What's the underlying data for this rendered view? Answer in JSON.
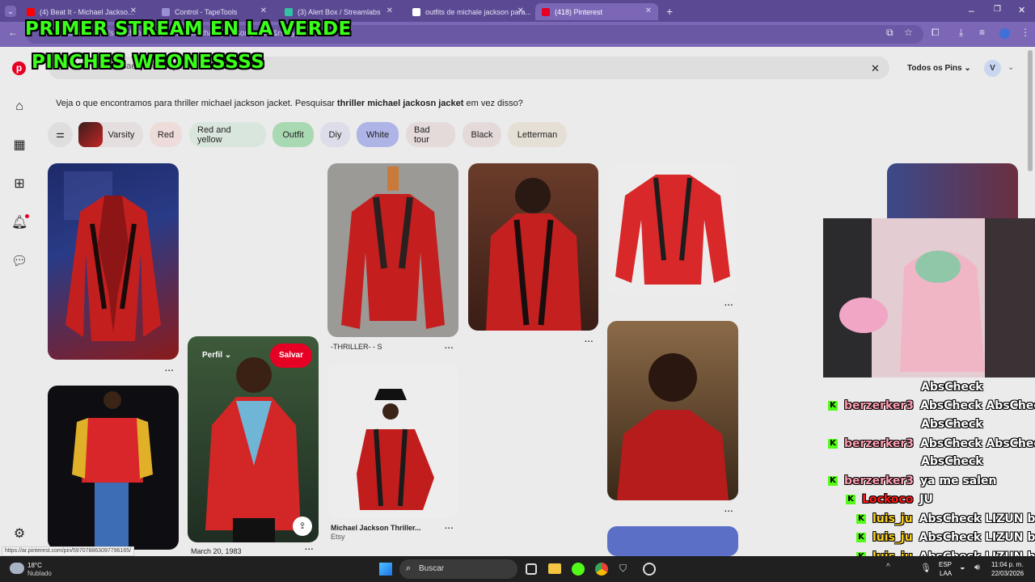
{
  "browser": {
    "tabs": [
      {
        "label": "(4) Beat It - Michael Jackso...",
        "fav_color": "#ff0000",
        "active": false
      },
      {
        "label": "Control - TapeTools",
        "fav_color": "#9a8fd0",
        "active": false
      },
      {
        "label": "(3) Alert Box / Streamlabs",
        "fav_color": "#31c3a2",
        "active": false
      },
      {
        "label": "outfits de michale jackson para...",
        "fav_color": "#ffffff",
        "active": false
      },
      {
        "label": "(418) Pinterest",
        "fav_color": "#e60023",
        "active": true
      }
    ],
    "new_tab": "+",
    "url": "ar.pinterest.com/search/pins/?q=thriller michael jackson jacket&rs=typed",
    "status_url": "https://ar.pinterest.com/pin/597078863097796165/"
  },
  "overlay": {
    "line1": "PRIMER STREAM EN LA VERDE",
    "line2": "PINCHES WEONESSSS"
  },
  "pinterest": {
    "search_value": "thriller michael jackson jacket",
    "scope_label": "Todos os Pins",
    "avatar_letter": "V",
    "suggest_prefix": "Veja o que encontramos para thriller michael jackson jacket. Pesquisar ",
    "suggest_bold": "thriller michael jackosn jacket",
    "suggest_suffix": " em vez disso?",
    "chips": [
      {
        "label": "Varsity",
        "color": "#e5dede"
      },
      {
        "label": "Red",
        "color": "#eddcd9"
      },
      {
        "label": "Red and yellow",
        "color": "#d9e6dd"
      },
      {
        "label": "Outfit",
        "color": "#a9d9b2"
      },
      {
        "label": "Diy",
        "color": "#dcdde8"
      },
      {
        "label": "White",
        "color": "#aeb4e6"
      },
      {
        "label": "Bad tour",
        "color": "#e4dada"
      },
      {
        "label": "Black",
        "color": "#e4dada"
      },
      {
        "label": "Letterman",
        "color": "#e6dfd6"
      }
    ],
    "pins": {
      "p2_perfil": "Perfil",
      "p2_save": "Salvar",
      "p2_caption": "March 20, 1983",
      "p3_caption": "-THRILLER- - S",
      "p4_title": "Michael Jackson Thriller...",
      "p4_source": "Etsy",
      "dots": "..."
    }
  },
  "chat": [
    {
      "user": "",
      "user_color": "#ff9fb2",
      "msg": "AbsCheck"
    },
    {
      "user": "berzerker3",
      "user_color": "#ff9fb2",
      "msg": "AbsCheck AbsCheck"
    },
    {
      "user": "",
      "user_color": "#ff9fb2",
      "msg": "AbsCheck"
    },
    {
      "user": "berzerker3",
      "user_color": "#ff9fb2",
      "msg": "AbsCheck AbsCheck"
    },
    {
      "user": "",
      "user_color": "#ff9fb2",
      "msg": "AbsCheck"
    },
    {
      "user": "berzerker3",
      "user_color": "#ff9fb2",
      "msg": "ya me salen"
    },
    {
      "user": "Lockoco",
      "user_color": "#ff1a1a",
      "msg": "JU"
    },
    {
      "user": "luis_ju",
      "user_color": "#ffd21f",
      "msg": "AbsCheck LIZUN be"
    },
    {
      "user": "luis_ju",
      "user_color": "#ffd21f",
      "msg": "AbsCheck LIZUN be"
    },
    {
      "user": "luis_ju",
      "user_color": "#ffd21f",
      "msg": "AbsCheck LIZUN be"
    }
  ],
  "taskbar": {
    "weather_temp": "18°C",
    "weather_text": "Nublado",
    "search_placeholder": "Buscar",
    "lang_top": "ESP",
    "lang_bottom": "LAA",
    "time": "11:04 p. m.",
    "date": "22/03/2026"
  }
}
